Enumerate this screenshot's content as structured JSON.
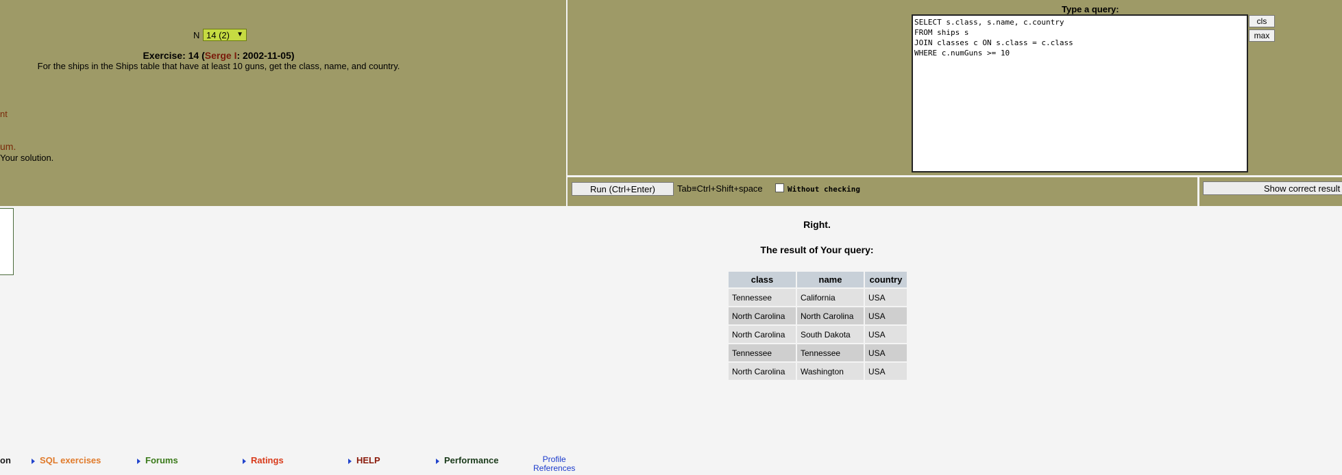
{
  "exercise": {
    "n_label": "N",
    "n_value": "14 (2)",
    "title_prefix": "Exercise: 14 (",
    "author": "Serge I",
    "title_suffix": ": 2002-11-05)",
    "text": "For the ships in the Ships table that have at least 10 guns, get the class, name, and country."
  },
  "left_fragments": [
    "nt",
    "um.",
    " Your solution."
  ],
  "query": {
    "label": "Type a query:",
    "text": "SELECT s.class, s.name, c.country\nFROM ships s\nJOIN classes c ON s.class = c.class\nWHERE c.numGuns >= 10",
    "cls_label": "cls",
    "max_label": "max"
  },
  "controls": {
    "run_label": "Run (Ctrl+Enter)",
    "tab_hint": "Tab≡Ctrl+Shift+space",
    "without_checking": "Without checking",
    "show_correct": "Show correct result"
  },
  "result": {
    "status": "Right.",
    "title": "The result of Your query:",
    "columns": [
      "class",
      "name",
      "country"
    ],
    "rows": [
      [
        "Tennessee",
        "California",
        "USA"
      ],
      [
        "North Carolina",
        "North Carolina",
        "USA"
      ],
      [
        "North Carolina",
        "South Dakota",
        "USA"
      ],
      [
        "Tennessee",
        "Tennessee",
        "USA"
      ],
      [
        "North Carolina",
        "Washington",
        "USA"
      ]
    ]
  },
  "footer": {
    "items": [
      {
        "label": "on",
        "color": "#1a1a1a"
      },
      {
        "label": "SQL exercises",
        "color": "#e07a2a"
      },
      {
        "label": "Forums",
        "color": "#3a7a1a"
      },
      {
        "label": "Ratings",
        "color": "#d83a1a"
      },
      {
        "label": "HELP",
        "color": "#8a1a0a"
      },
      {
        "label": "Performance",
        "color": "#1a3a1a"
      }
    ],
    "profile": "Profile",
    "references": "References"
  }
}
